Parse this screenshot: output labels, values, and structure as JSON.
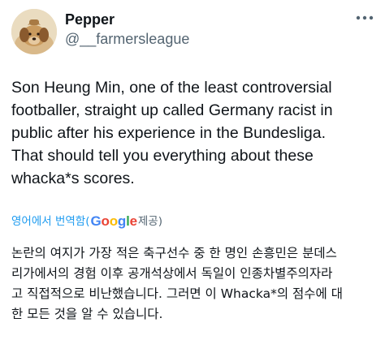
{
  "author": {
    "display_name": "Pepper",
    "handle": "@__farmersleague",
    "avatar_icon": "dog-avatar"
  },
  "more_icon": "more-horizontal-icon",
  "tweet_lines": [
    "Son Heung Min, one of the least controversial",
    "footballer, straight up called Germany racist in",
    "public after his experience in the Bundesliga.",
    "That should tell you everything about these",
    "whacka*s scores."
  ],
  "translation": {
    "link_label": "영어에서 번역함(",
    "google_letters": [
      "G",
      "o",
      "o",
      "g",
      "l",
      "e"
    ],
    "google_colors": [
      "#4285F4",
      "#EA4335",
      "#FBBC05",
      "#4285F4",
      "#34A853",
      "#EA4335"
    ],
    "suffix": " 제공)",
    "link_color": "#1d9bf0",
    "lines": [
      "논란의 여지가 가장 적은 축구선수 중 한 명인 손흥민은 분데스",
      "리가에서의 경험 이후 공개석상에서 독일이 인종차별주의자라",
      "고 직접적으로 비난했습니다. 그러면 이 Whacka*의 점수에 대",
      "한 모든 것을 알 수 있습니다."
    ]
  }
}
